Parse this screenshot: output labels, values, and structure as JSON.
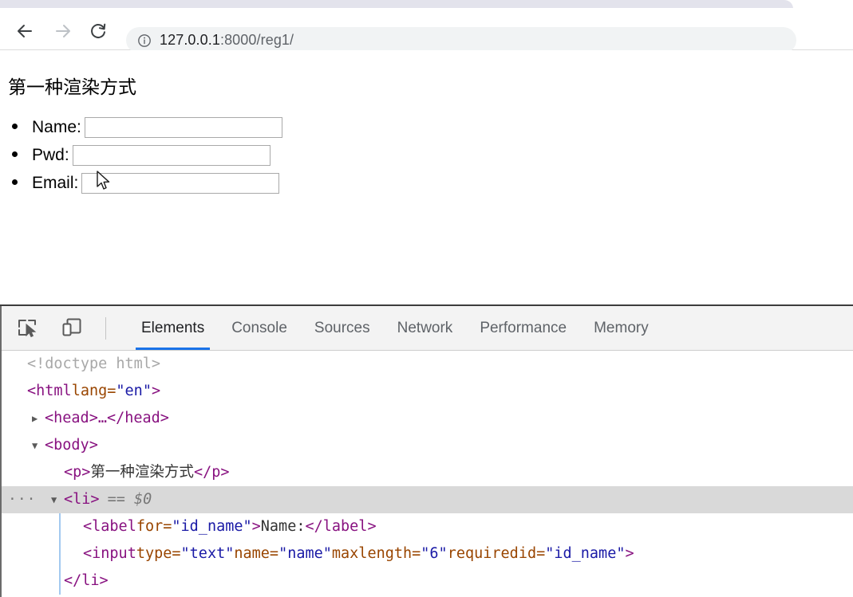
{
  "browser": {
    "nav": {
      "back_label": "Back",
      "forward_label": "Forward",
      "reload_label": "Reload"
    },
    "omnibox": {
      "security_icon": "info-circle-icon",
      "url_host": "127.0.0.1",
      "url_path": ":8000/reg1/",
      "url_full": "127.0.0.1:8000/reg1/"
    }
  },
  "page": {
    "heading": "第一种渲染方式",
    "fields": [
      {
        "label": "Name:",
        "value": "",
        "type": "text",
        "name": "name",
        "id": "id_name",
        "maxlength": "6",
        "width_class": "in-name"
      },
      {
        "label": "Pwd:",
        "value": "",
        "type": "text",
        "name": "pwd",
        "id": "id_pwd",
        "maxlength": "",
        "width_class": "in-pwd"
      },
      {
        "label": "Email:",
        "value": "",
        "type": "email",
        "name": "email",
        "id": "id_email",
        "maxlength": "",
        "width_class": "in-email"
      }
    ],
    "cursor_icon": "mouse-pointer-icon"
  },
  "devtools": {
    "toolbar_icons": [
      {
        "name": "inspect-element-icon",
        "title": "Inspect element"
      },
      {
        "name": "device-toolbar-icon",
        "title": "Toggle device toolbar"
      }
    ],
    "tabs": [
      {
        "label": "Elements",
        "active": true
      },
      {
        "label": "Console",
        "active": false
      },
      {
        "label": "Sources",
        "active": false
      },
      {
        "label": "Network",
        "active": false
      },
      {
        "label": "Performance",
        "active": false
      },
      {
        "label": "Memory",
        "active": false
      }
    ],
    "accent_color": "#1a73e8",
    "dom": {
      "doctype": "<!doctype html>",
      "html_open_tag": "<html",
      "html_attr_name": " lang=",
      "html_attr_value": "\"en\"",
      "html_close_bracket": ">",
      "head_collapsed": "<head>…</head>",
      "body_open": "<body>",
      "p_open": "<p>",
      "p_text": "第一种渲染方式",
      "p_close": "</p>",
      "li_open": "<li>",
      "li_selected_marker": "== $0",
      "li_ellipsis": "···",
      "label_open": "<label",
      "label_attr_name": " for=",
      "label_attr_value": "\"id_name\"",
      "label_gt": ">",
      "label_text": "Name:",
      "label_close": "</label>",
      "input_open": "<input",
      "input_type_name": " type=",
      "input_type_value": "\"text\"",
      "input_name_name": " name=",
      "input_name_value": "\"name\"",
      "input_maxlength_name": " maxlength=",
      "input_maxlength_value": "\"6\"",
      "input_required": " required",
      "input_id_name": " id=",
      "input_id_value": "\"id_name\"",
      "input_gt": ">",
      "li_close": "</li>"
    }
  }
}
